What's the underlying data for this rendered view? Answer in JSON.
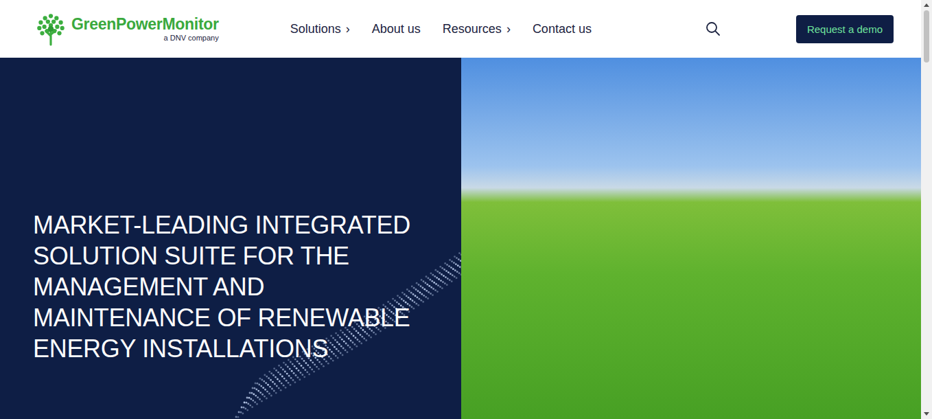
{
  "logo": {
    "name": "GreenPowerMonitor",
    "tagline": "a DNV company"
  },
  "nav": [
    {
      "label": "Solutions",
      "arrow": "›"
    },
    {
      "label": "About us",
      "arrow": ""
    },
    {
      "label": "Resources",
      "arrow": "›"
    },
    {
      "label": "Contact us",
      "arrow": ""
    }
  ],
  "cta": "Request a demo",
  "hero": {
    "headline": "MARKET-LEADING INTEGRATED SOLUTION SUITE FOR THE MANAGEMENT AND MAINTENANCE OF RENEWABLE ENERGY INSTALLATIONS"
  }
}
